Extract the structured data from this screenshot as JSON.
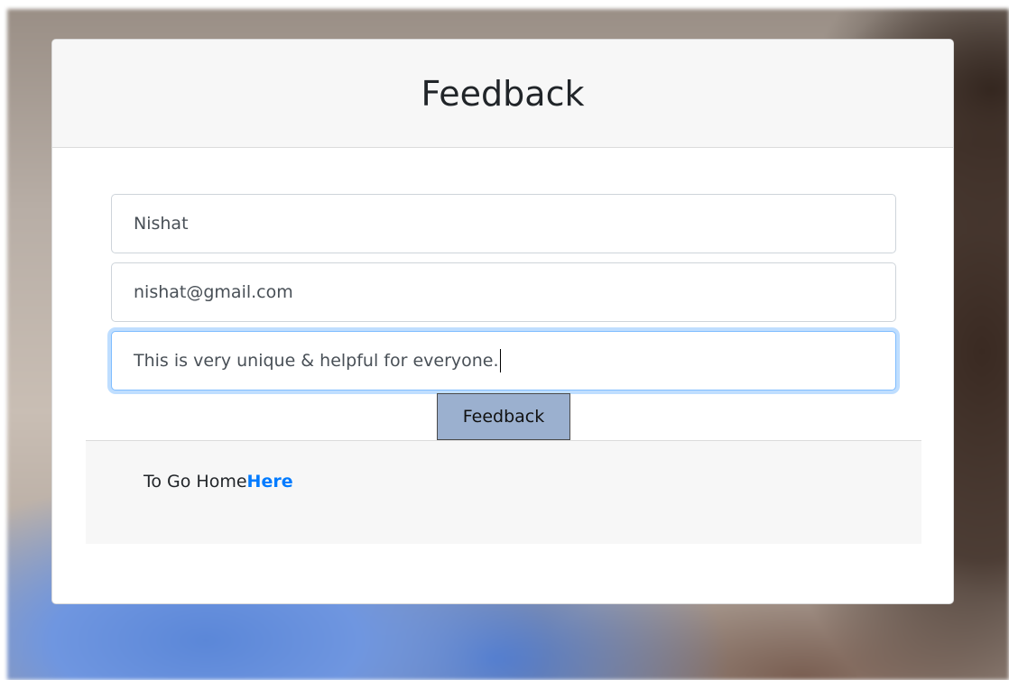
{
  "page": {
    "title": "Feedback"
  },
  "form": {
    "name_value": "Nishat",
    "email_value": "nishat@gmail.com",
    "message_value": "This is very unique & helpful for everyone.",
    "submit_label": "Feedback"
  },
  "footer": {
    "text": "To Go Home",
    "link_label": "Here"
  },
  "colors": {
    "link": "#007bff",
    "button_bg": "#9bb0cf",
    "focus_ring": "#80bdff"
  }
}
